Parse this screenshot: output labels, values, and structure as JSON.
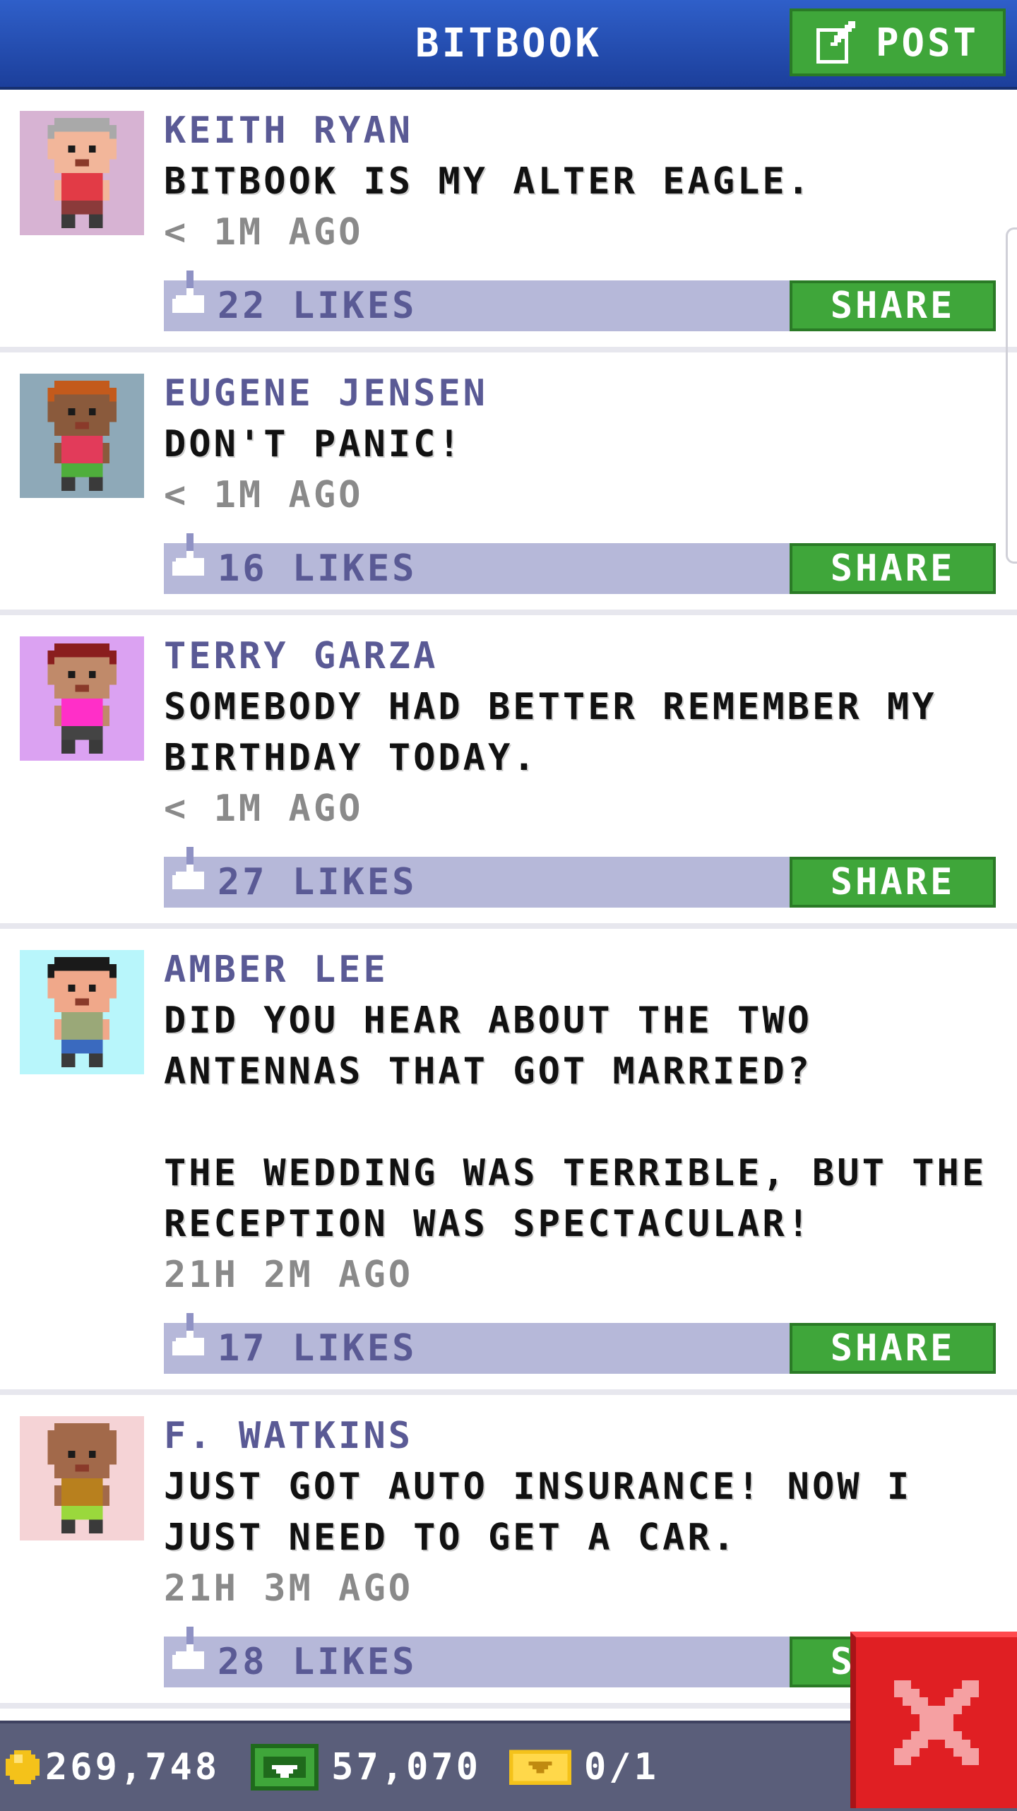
{
  "header": {
    "title": "BITBOOK",
    "post_label": "POST",
    "post_icon": "edit-icon"
  },
  "posts": [
    {
      "author": "KEITH RYAN",
      "message": "BITBOOK IS MY ALTER EAGLE.",
      "time": "< 1M AGO",
      "likes": "22 LIKES",
      "share_label": "SHARE",
      "avatar_bg": "#d7b3d3",
      "skin": "#f2b69a",
      "shirt": "#e23b46",
      "hair": "#a9a9a9",
      "pants": "#8b3a3a"
    },
    {
      "author": "EUGENE JENSEN",
      "message": "DON'T PANIC!",
      "time": "< 1M AGO",
      "likes": "16 LIKES",
      "share_label": "SHARE",
      "avatar_bg": "#8ea9b8",
      "skin": "#8a5a3c",
      "shirt": "#e23b5a",
      "hair": "#c35a1c",
      "pants": "#4fae3c"
    },
    {
      "author": "TERRY GARZA",
      "message": "SOMEBODY HAD BETTER REMEMBER MY BIRTHDAY TODAY.",
      "time": "< 1M AGO",
      "likes": "27 LIKES",
      "share_label": "SHARE",
      "avatar_bg": "#dba2f2",
      "skin": "#c08a6a",
      "shirt": "#ff2fc8",
      "hair": "#8a1e1e",
      "pants": "#444444"
    },
    {
      "author": "AMBER LEE",
      "message": "DID YOU HEAR ABOUT THE TWO ANTENNAS THAT GOT MARRIED?\n\nTHE WEDDING WAS TERRIBLE, BUT THE RECEPTION WAS SPECTACULAR!",
      "time": "21H 2M AGO",
      "likes": "17 LIKES",
      "share_label": "SHARE",
      "avatar_bg": "#b8f6fb",
      "skin": "#f0a88a",
      "shirt": "#9aa878",
      "hair": "#1a1a1a",
      "pants": "#3a6abf"
    },
    {
      "author": "F. WATKINS",
      "message": "JUST GOT AUTO INSURANCE! NOW I JUST NEED TO GET A CAR.",
      "time": "21H 3M AGO",
      "likes": "28 LIKES",
      "share_label": "SHARE",
      "avatar_bg": "#f5d3d6",
      "skin": "#a2694a",
      "shirt": "#b8801e",
      "hair": "#a2694a",
      "pants": "#9ad83c"
    }
  ],
  "status_bar": {
    "coins": "269,748",
    "bux": "57,070",
    "tickets": "0/1",
    "coin_icon": "coin-icon",
    "bux_icon": "bux-icon",
    "ticket_icon": "ticket-icon"
  },
  "close_icon": "close-icon"
}
